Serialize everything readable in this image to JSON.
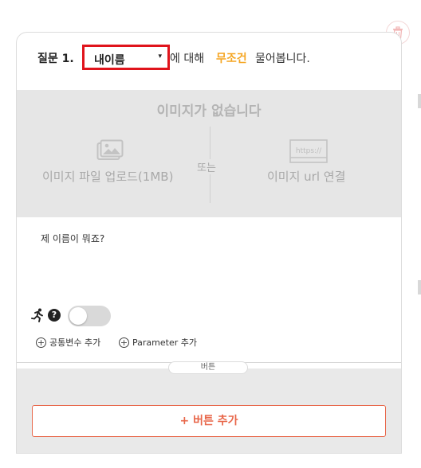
{
  "question": {
    "label": "질문 1.",
    "variable_selected": "내이름",
    "caret": "▾",
    "about_text": "에 대해",
    "mode": "무조건",
    "suffix": "물어봅니다.",
    "message": "제 이름이 뭐죠?"
  },
  "image_area": {
    "title": "이미지가 없습니다",
    "or_text": "또는",
    "upload_label": "이미지 파일 업로드(1MB)",
    "url_label": "이미지 url 연결",
    "url_icon_text": "https://"
  },
  "options": {
    "help_symbol": "?",
    "toggle_on": false,
    "add_common_variable": "공통변수 추가",
    "add_parameter": "Parameter 추가"
  },
  "buttons_section": {
    "tag": "버튼",
    "add_button_label": "+ 버튼 추가"
  },
  "colors": {
    "select_border": "#e0141c",
    "mode_accent": "#f5a623",
    "add_button_accent": "#e8674a"
  }
}
